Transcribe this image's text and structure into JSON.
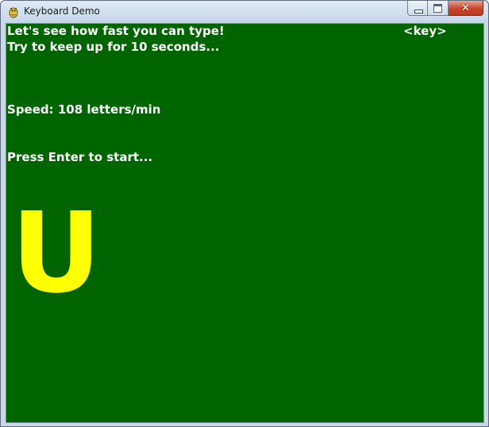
{
  "window": {
    "title": "Keyboard Demo",
    "icon": "python-snake-icon",
    "controls": {
      "minimize": "minimize-icon",
      "maximize": "maximize-icon",
      "close": "close-icon",
      "close_glyph": "✕"
    }
  },
  "game": {
    "intro_line1": "Let's see how fast you can type!",
    "intro_line2": "Try to keep up for 10 seconds...",
    "key_label": "<key>",
    "speed_text": "Speed: 108 letters/min",
    "prompt_text": "Press Enter to start...",
    "target_letter": "U"
  },
  "colors": {
    "background": "#006400",
    "text": "#ffffff",
    "letter": "#ffff00"
  }
}
